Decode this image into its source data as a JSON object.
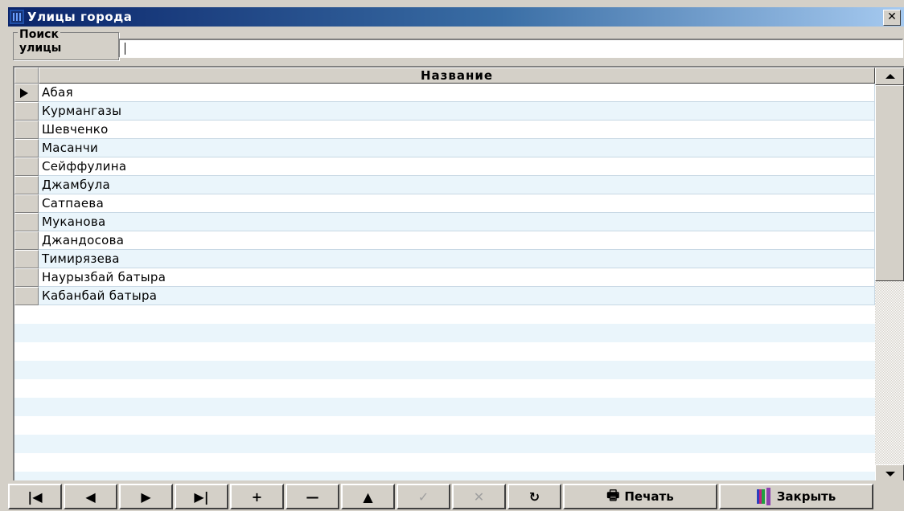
{
  "window": {
    "title": "Улицы города",
    "close_glyph": "✕"
  },
  "search": {
    "label_line1": "Поиск",
    "label_line2": "улицы",
    "value": ""
  },
  "grid": {
    "column_header": "Название",
    "selected_row": 0,
    "rows": [
      "Абая",
      "Курмангазы",
      "Шевченко",
      "Масанчи",
      "Сейффулина",
      "Джамбула",
      "Сатпаева",
      "Муканова",
      "Джандосова",
      "Тимирязева",
      "Наурызбай батыра",
      "Кабанбай батыра"
    ]
  },
  "navigator": {
    "first": "|◀",
    "prior": "◀",
    "next": "▶",
    "last": "▶|",
    "insert": "+",
    "delete": "—",
    "edit": "▲",
    "post": "✓",
    "cancel": "✕",
    "refresh": "↻",
    "print_label": "Печать",
    "close_label": "Закрыть"
  },
  "icons": {
    "print": "printer-icon",
    "close": "books-icon"
  }
}
